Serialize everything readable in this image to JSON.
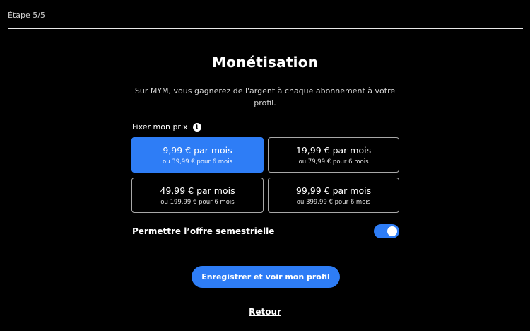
{
  "step": {
    "label": "Étape 5/5"
  },
  "header": {
    "title": "Monétisation",
    "subtitle": "Sur MYM, vous gagnerez de l'argent à chaque abonnement à votre profil."
  },
  "pricing": {
    "label": "Fixer mon prix",
    "info_icon": "info-icon",
    "options": [
      {
        "main": "9,99 € par mois",
        "sub": "ou 39,99 € pour 6 mois",
        "selected": true
      },
      {
        "main": "19,99 € par mois",
        "sub": "ou 79,99 € pour 6 mois",
        "selected": false
      },
      {
        "main": "49,99 € par mois",
        "sub": "ou 199,99 € pour 6 mois",
        "selected": false
      },
      {
        "main": "99,99 € par mois",
        "sub": "ou 399,99 € pour 6 mois",
        "selected": false
      }
    ]
  },
  "semester_offer": {
    "label": "Permettre l’offre semestrielle",
    "enabled": true
  },
  "actions": {
    "save_label": "Enregistrer et voir mon profil",
    "back_label": "Retour"
  },
  "colors": {
    "accent": "#2e7df6",
    "background": "#000000"
  }
}
